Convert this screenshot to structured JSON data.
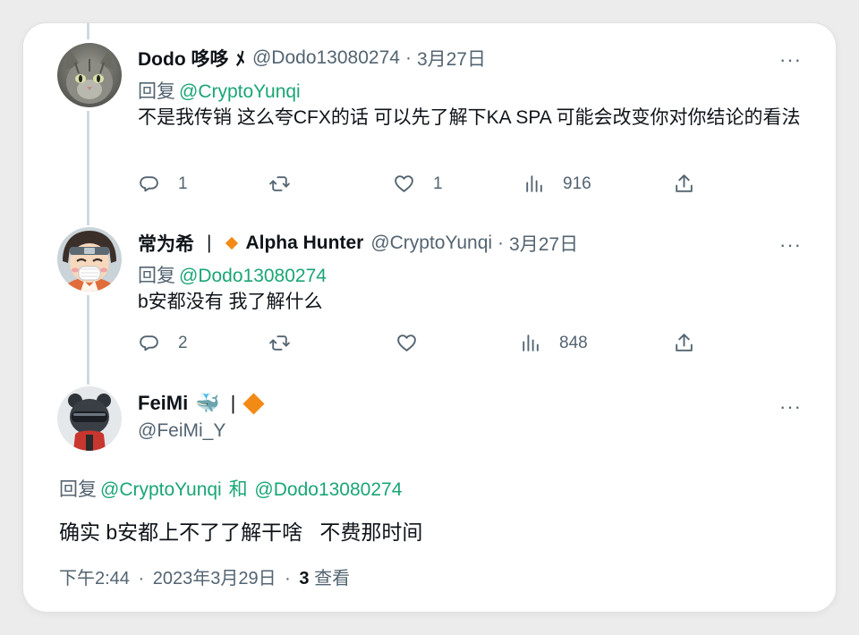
{
  "tweets": [
    {
      "name": "Dodo 哆哆",
      "badge": "ﾒ",
      "handle": "@Dodo13080274",
      "date": "3月27日",
      "reply_prefix": "回复",
      "reply_to": "@CryptoYunqi",
      "text": "不是我传销 这么夸CFX的话 可以先了解下KA SPA 可能会改变你对你结论的看法",
      "replies": "1",
      "retweets": "",
      "likes": "1",
      "views": "916"
    },
    {
      "name": "常为希",
      "bar": "|",
      "name2": "Alpha Hunter",
      "handle": "@CryptoYunqi",
      "date": "3月27日",
      "reply_prefix": "回复",
      "reply_to": "@Dodo13080274",
      "text": "b安都没有 我了解什么",
      "replies": "2",
      "retweets": "",
      "likes": "",
      "views": "848"
    }
  ],
  "main": {
    "name": "FeiMi",
    "whale": "🐳",
    "bar": "|",
    "handle": "@FeiMi_Y",
    "reply_prefix": "回复",
    "reply_to_1": "@CryptoYunqi",
    "reply_and": "和",
    "reply_to_2": "@Dodo13080274",
    "text": "确实 b安都上不了了解干啥   不费那时间",
    "time": "下午2:44",
    "date": "2023年3月29日",
    "views_count": "3",
    "views_label": "查看"
  },
  "more_label": "···",
  "dot": "·",
  "colors": {
    "accent": "#1aa674",
    "muted": "#536471",
    "badge": "#f28a15"
  },
  "icons": [
    "reply-icon",
    "retweet-icon",
    "like-icon",
    "views-icon",
    "share-icon",
    "more-icon"
  ]
}
